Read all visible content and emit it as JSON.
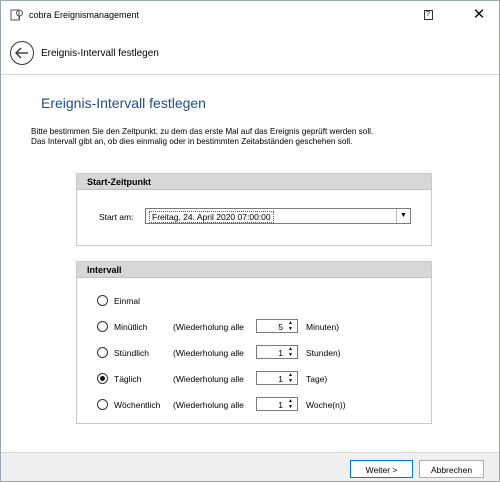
{
  "window": {
    "title": "cobra Ereignismanagement",
    "help_label": "?",
    "close_label": "✕",
    "icon": "cobra-app-icon"
  },
  "nav": {
    "back_icon": "back-arrow-icon",
    "title": "Ereignis-Intervall festlegen"
  },
  "page": {
    "heading": "Ereignis-Intervall festlegen",
    "description_line1": "Bitte bestimmen Sie den Zeitpunkt, zu dem das erste Mal auf das Ereignis geprüft werden soll.",
    "description_line2": "Das Intervall gibt an, ob dies einmalig oder in bestimmten Zeitabständen geschehen soll."
  },
  "start": {
    "section_title": "Start-Zeitpunkt",
    "label": "Start am:",
    "value": "Freitag, 24. April 2020 07:00:00"
  },
  "interval": {
    "section_title": "Intervall",
    "selected": "Täglich",
    "options": [
      {
        "label": "Einmal"
      },
      {
        "label": "Minütlich",
        "prefix": "(Wiederholung alle",
        "value": "5",
        "unit": "Minuten)"
      },
      {
        "label": "Stündlich",
        "prefix": "(Wiederholung alle",
        "value": "1",
        "unit": "Stunden)"
      },
      {
        "label": "Täglich",
        "prefix": "(Wiederholung alle",
        "value": "1",
        "unit": "Tage)"
      },
      {
        "label": "Wöchentlich",
        "prefix": "(Wiederholung alle",
        "value": "1",
        "unit": "Woche(n))"
      }
    ]
  },
  "footer": {
    "next_label": "Weiter >",
    "cancel_label": "Abbrechen"
  },
  "colors": {
    "heading": "#1f4e8c",
    "panel_header": "#d7d7d7",
    "footer_bg": "#f0f0f0",
    "primary_border": "#0078d7"
  }
}
